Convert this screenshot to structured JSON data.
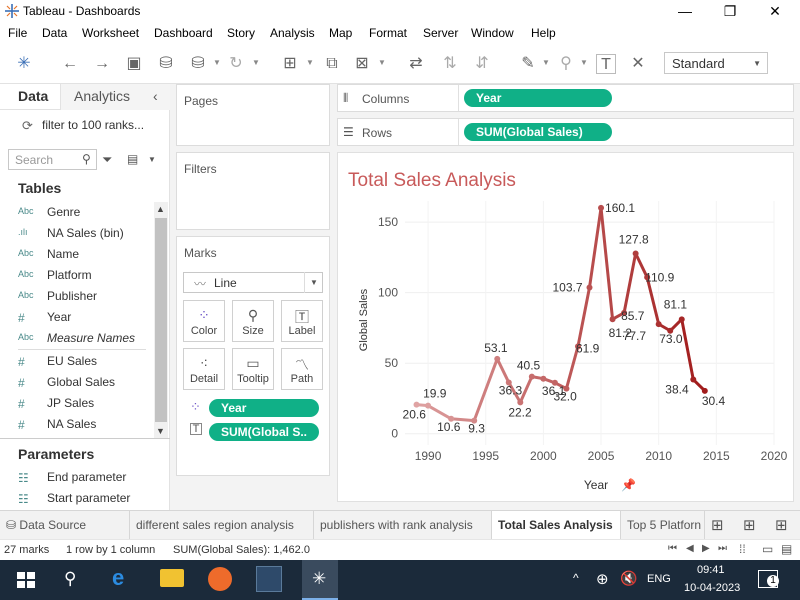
{
  "window": {
    "title": "Tableau - Dashboards",
    "minimize": "—",
    "maximize": "❐",
    "close": "✕"
  },
  "menu": [
    "File",
    "Data",
    "Worksheet",
    "Dashboard",
    "Story",
    "Analysis",
    "Map",
    "Format",
    "Server",
    "Window",
    "Help"
  ],
  "toolbar": {
    "fit_select": "Standard"
  },
  "data_pane": {
    "tabs": [
      "Data",
      "Analytics"
    ],
    "datasource": "filter to 100 ranks...",
    "search_placeholder": "Search",
    "tables_header": "Tables",
    "fields": [
      {
        "type": "Abc",
        "name": "Genre"
      },
      {
        "type": ".ılı",
        "name": "NA Sales (bin)"
      },
      {
        "type": "Abc",
        "name": "Name"
      },
      {
        "type": "Abc",
        "name": "Platform"
      },
      {
        "type": "Abc",
        "name": "Publisher"
      },
      {
        "type": "#",
        "name": "Year"
      },
      {
        "type": "Abc",
        "name": "Measure Names"
      },
      {
        "type": "#",
        "name": "EU Sales"
      },
      {
        "type": "#",
        "name": "Global Sales"
      },
      {
        "type": "#",
        "name": "JP Sales"
      },
      {
        "type": "#",
        "name": "NA Sales"
      }
    ],
    "parameters_header": "Parameters",
    "parameters": [
      "End parameter",
      "Start parameter"
    ]
  },
  "shelves": {
    "pages": "Pages",
    "filters": "Filters",
    "columns_label": "Columns",
    "columns_pill": "Year",
    "rows_label": "Rows",
    "rows_pill": "SUM(Global Sales)"
  },
  "marks": {
    "header": "Marks",
    "type": "Line",
    "buttons": [
      "Color",
      "Size",
      "Label",
      "Detail",
      "Tooltip",
      "Path"
    ],
    "pills": [
      "Year",
      "SUM(Global S.."
    ]
  },
  "chart_data": {
    "type": "line",
    "title": "Total Sales Analysis",
    "xlabel": "Year",
    "ylabel": "Global Sales",
    "xlim": [
      1988,
      2020
    ],
    "ylim": [
      -8,
      165
    ],
    "x_ticks": [
      1990,
      1995,
      2000,
      2005,
      2010,
      2015,
      2020
    ],
    "y_ticks": [
      0,
      50,
      100,
      150
    ],
    "x": [
      1989,
      1990,
      1992,
      1994,
      1996,
      1997,
      1998,
      1999,
      2000,
      2001,
      2002,
      2003,
      2004,
      2005,
      2006,
      2007,
      2008,
      2009,
      2010,
      2011,
      2012,
      2013,
      2014,
      2015
    ],
    "values": [
      20.6,
      19.9,
      10.6,
      9.3,
      53.1,
      36.3,
      22.2,
      40.5,
      39.0,
      36.1,
      32.0,
      61.9,
      103.7,
      160.1,
      81.2,
      85.7,
      127.8,
      110.9,
      77.7,
      73.0,
      81.1,
      38.4,
      30.4,
      null
    ],
    "data_labels": [
      "20.6",
      "19.9",
      "10.6",
      "9.3",
      "53.1",
      "36.3",
      "22.2",
      "40.5",
      "",
      "36.1",
      "32.0",
      "61.9",
      "103.7",
      "160.1",
      "81.2",
      "85.7",
      "127.8",
      "110.9",
      "77.7",
      "73.0",
      "81.1",
      "38.4",
      "30.4",
      ""
    ],
    "color_light": "#e0a4a4",
    "color_dark": "#a11c1c",
    "grid": true
  },
  "sheets": {
    "tabs": [
      "Data Source",
      "different sales region analysis",
      "publishers with rank analysis",
      "Total Sales Analysis",
      "Top 5 Platforn"
    ],
    "active": "Total Sales Analysis"
  },
  "status": {
    "marks": "27 marks",
    "layout": "1 row by 1 column",
    "sum": "SUM(Global Sales): 1,462.0"
  },
  "taskbar": {
    "lang": "ENG",
    "time": "09:41",
    "date": "10-04-2023",
    "notifications": "1"
  }
}
